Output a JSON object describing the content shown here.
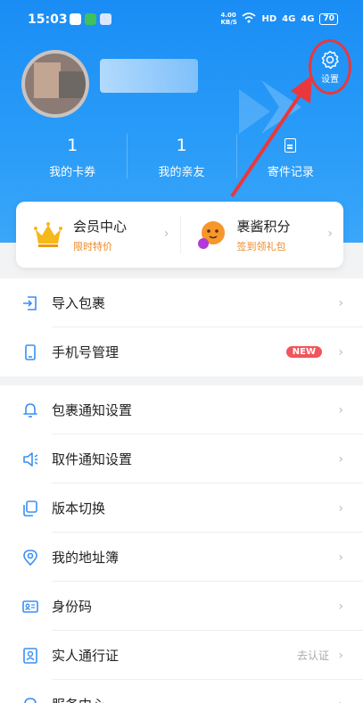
{
  "status_bar": {
    "time": "15:03",
    "net_speed": "4.00 KB/S",
    "network_label": "HD",
    "signal1": "4G",
    "signal2": "4G",
    "battery": "70"
  },
  "header": {
    "settings_label": "设置",
    "stats": [
      {
        "value": "1",
        "label": "我的卡券"
      },
      {
        "value": "1",
        "label": "我的亲友"
      },
      {
        "value": "",
        "label": "寄件记录"
      }
    ]
  },
  "cards": [
    {
      "title": "会员中心",
      "subtitle": "限时特价",
      "icon": "crown-icon"
    },
    {
      "title": "裹酱积分",
      "subtitle": "签到领礼包",
      "icon": "mascot-icon"
    }
  ],
  "menu": {
    "group1": [
      {
        "label": "导入包裹",
        "icon": "import-icon"
      },
      {
        "label": "手机号管理",
        "icon": "phone-icon",
        "badge": "NEW"
      }
    ],
    "group2": [
      {
        "label": "包裹通知设置",
        "icon": "bell-icon"
      },
      {
        "label": "取件通知设置",
        "icon": "speaker-icon"
      },
      {
        "label": "版本切换",
        "icon": "switch-icon"
      },
      {
        "label": "我的地址簿",
        "icon": "location-icon"
      },
      {
        "label": "身份码",
        "icon": "id-card-icon"
      },
      {
        "label": "实人通行证",
        "icon": "person-pass-icon",
        "aux": "去认证"
      },
      {
        "label": "服务中心",
        "icon": "service-icon"
      }
    ]
  },
  "colors": {
    "primary": "#1a8df5",
    "accent_red": "#e8383d",
    "orange": "#f08a24",
    "badge": "#f2545b"
  }
}
